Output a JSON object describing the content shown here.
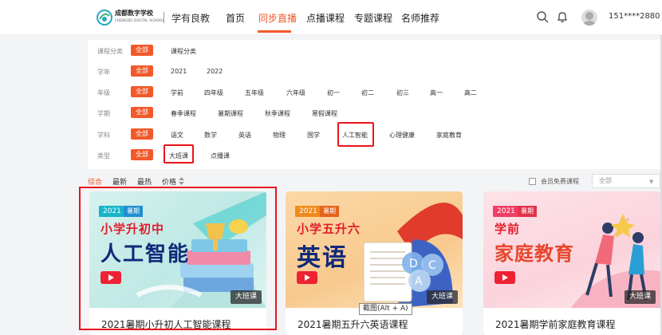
{
  "header": {
    "logo_text": "成都数字学校",
    "logo_sub": "CHENGDU DIGITAL SCHOOL",
    "slogan": "学有良教",
    "nav": [
      "首页",
      "同步直播",
      "点播课程",
      "专题课程",
      "名师推荐"
    ],
    "active_nav": "同步直播",
    "user": "151****2880",
    "icons": [
      "search-icon",
      "bell-icon",
      "avatar"
    ]
  },
  "filters": {
    "all_label": "全部",
    "rows": [
      {
        "label": "课程分类",
        "items": [
          "课程分类"
        ]
      },
      {
        "label": "学年",
        "items": [
          "2021",
          "2022"
        ]
      },
      {
        "label": "年级",
        "items": [
          "学前",
          "四年级",
          "五年级",
          "六年级",
          "初一",
          "初二",
          "初三",
          "高一",
          "高二"
        ]
      },
      {
        "label": "学期",
        "items": [
          "春季课程",
          "暑期课程",
          "秋季课程",
          "寒假课程"
        ]
      },
      {
        "label": "学科",
        "items": [
          "语文",
          "数学",
          "英语",
          "物理",
          "国学",
          "人工智能",
          "心理健康",
          "家庭教育"
        ]
      },
      {
        "label": "类型",
        "items": [
          "大班课",
          "点播课"
        ]
      }
    ]
  },
  "sort": {
    "options": [
      "综合",
      "最新",
      "最热",
      "价格"
    ],
    "active": "综合",
    "vip_label": "会员免费课程",
    "select_value": "全部"
  },
  "cards": [
    {
      "year": "2021",
      "season": "暑期",
      "line1": "小学升初中",
      "line2": "人工智能",
      "badge": "大班课",
      "title": "2021暑期小升初人工智能课程"
    },
    {
      "year": "2021",
      "season": "暑期",
      "line1": "小学五升六",
      "line2": "英语",
      "badge": "大班课",
      "title": "2021暑期五升六英语课程"
    },
    {
      "year": "2021",
      "season": "暑期",
      "line1": "学前",
      "line2": "家庭教育",
      "badge": "大班课",
      "title": "2021暑期学前家庭教育课程"
    }
  ],
  "tooltip": "截图(Alt + A)",
  "colors": {
    "accent": "#f2592a",
    "highlight": "#e8141c"
  }
}
